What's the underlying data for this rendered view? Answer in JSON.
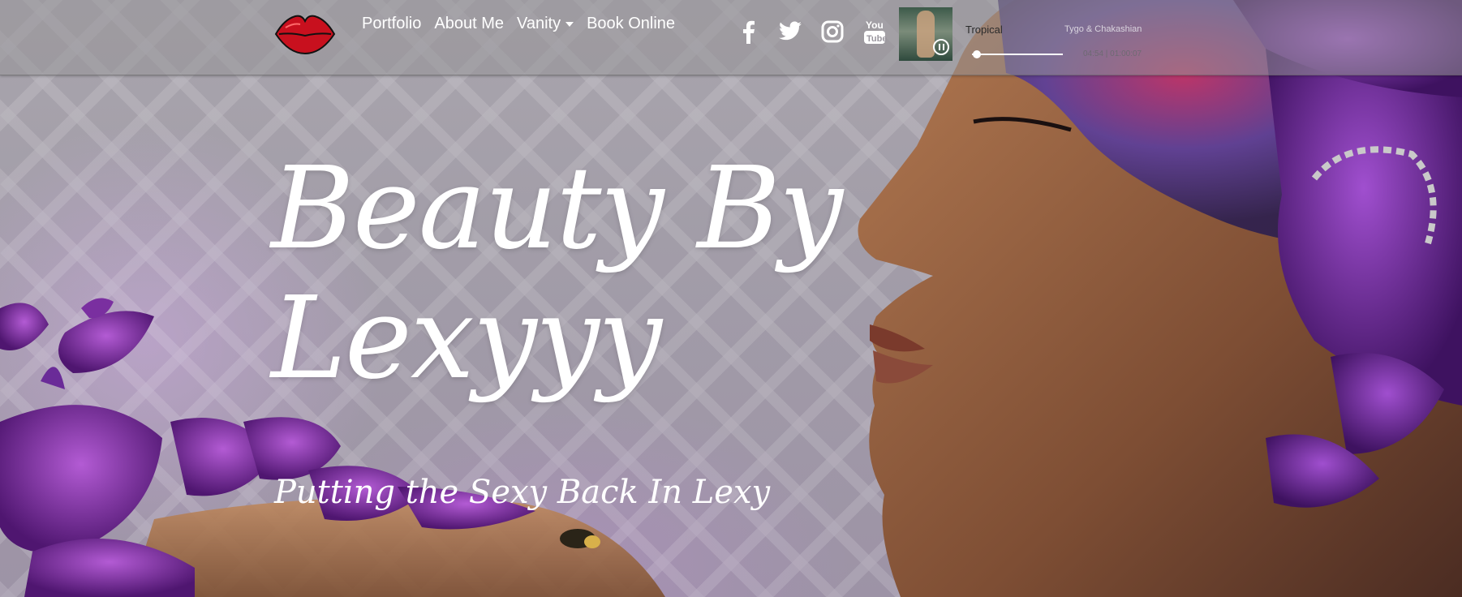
{
  "nav": {
    "links": [
      "Portfolio",
      "About Me",
      "Vanity",
      "Book Online"
    ],
    "social": [
      {
        "icon": "facebook-icon"
      },
      {
        "icon": "twitter-icon"
      },
      {
        "icon": "instagram-icon"
      },
      {
        "icon": "youtube-icon"
      }
    ]
  },
  "player": {
    "title": "Tropical",
    "artist": "Tygo & Chakashian",
    "time": "04:54 | 01:00:07",
    "progress": 0.05
  },
  "hero": {
    "title": "Beauty By Lexyyy",
    "subtitle": "Putting the Sexy Back In Lexy"
  },
  "colors": {
    "lips": "#c8101e",
    "accent": "#8b3fb5",
    "text": "#ffffff"
  }
}
